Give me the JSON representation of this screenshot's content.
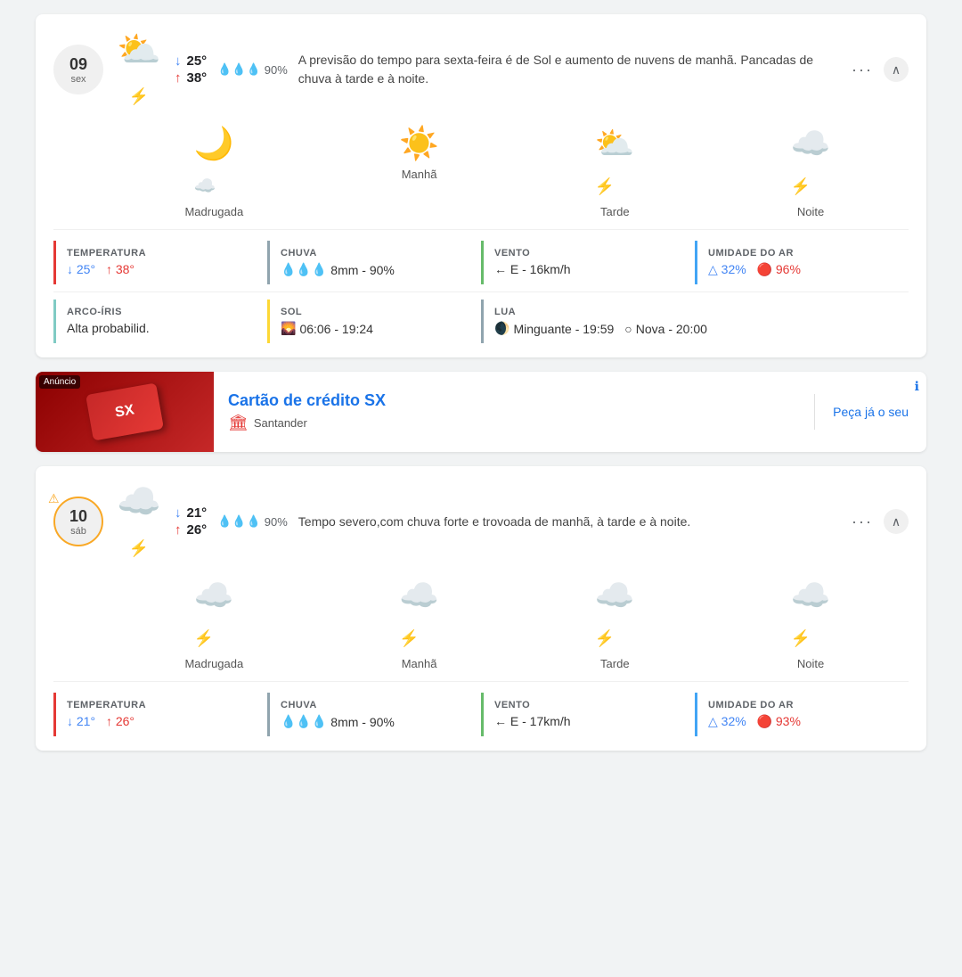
{
  "day1": {
    "number": "09",
    "name": "sex",
    "temp_low": "25°",
    "temp_high": "38°",
    "rain_pct": "90%",
    "description": "A previsão do tempo para sexta-feira é de Sol e aumento de nuvens de manhã. Pancadas de chuva à tarde e à noite.",
    "times": [
      "Madrugada",
      "Manhã",
      "Tarde",
      "Noite"
    ],
    "icons": [
      "🌙☁️",
      "☀️",
      "⛅⚡",
      "☁️⚡"
    ],
    "details": {
      "temperatura": {
        "title": "TEMPERATURA",
        "low": "↓ 25°",
        "high": "↑ 38°"
      },
      "chuva": {
        "title": "CHUVA",
        "value": "💧💧💧 8mm - 90%"
      },
      "vento": {
        "title": "VENTO",
        "value": "← E - 16km/h"
      },
      "umidade": {
        "title": "UMIDADE DO AR",
        "low": "△ 32%",
        "high": "🔴 96%"
      }
    },
    "details2": {
      "arco": {
        "title": "ARCO-ÍRIS",
        "value": "Alta probabilid."
      },
      "sol": {
        "title": "SOL",
        "value": "🌄 06:06 - 19:24"
      },
      "lua": {
        "title": "LUA",
        "value": "🌒 Minguante - 19:59  ○ Nova - 20:00"
      }
    }
  },
  "ad": {
    "badge": "Anúncio",
    "title": "Cartão de crédito SX",
    "brand": "Santander",
    "cta": "Peça já o seu",
    "card_text": "SX"
  },
  "day2": {
    "number": "10",
    "name": "sáb",
    "warning": true,
    "temp_low": "21°",
    "temp_high": "26°",
    "rain_pct": "90%",
    "description": "Tempo severo,com chuva forte e trovoada de manhã, à tarde e à noite.",
    "times": [
      "Madrugada",
      "Manhã",
      "Tarde",
      "Noite"
    ],
    "details": {
      "temperatura": {
        "title": "TEMPERATURA",
        "low": "↓ 21°",
        "high": "↑ 26°"
      },
      "chuva": {
        "title": "CHUVA",
        "value": "💧💧💧 8mm - 90%"
      },
      "vento": {
        "title": "VENTO",
        "value": "← E - 17km/h"
      },
      "umidade": {
        "title": "UMIDADE DO AR",
        "low": "△ 32%",
        "high": "🔴 93%"
      }
    }
  },
  "icons": {
    "dots": "···",
    "chevron_up": "∧",
    "arrow_down": "↓",
    "arrow_up": "↑",
    "arrow_left": "←"
  }
}
